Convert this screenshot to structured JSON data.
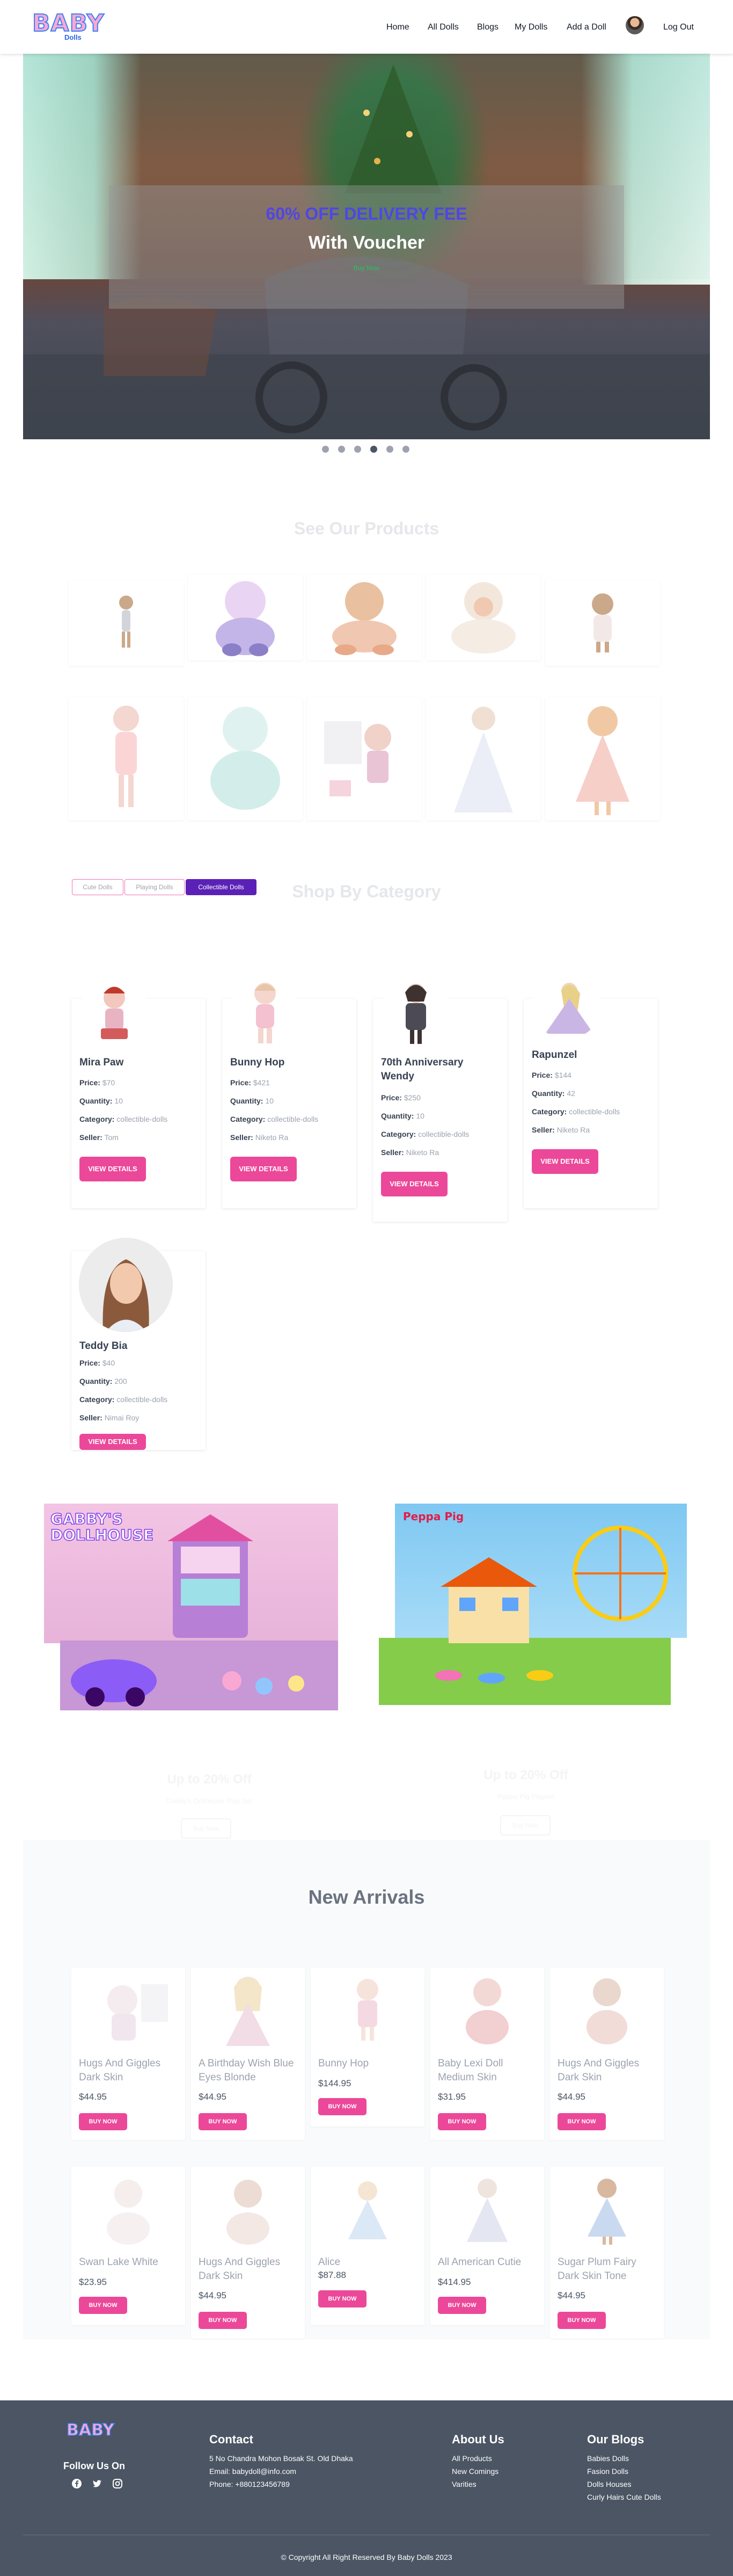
{
  "brand": {
    "logo_main": "BABY",
    "logo_sub": "Dolls"
  },
  "nav": {
    "items": [
      "Home",
      "All Dolls",
      "Blogs",
      "My Dolls",
      "Add a Doll"
    ],
    "logout": "Log Out"
  },
  "hero": {
    "headline": "60% OFF DELIVERY FEE",
    "subheadline": "With Voucher",
    "cta": "Buy Now",
    "slides": 6,
    "active_slide": 4
  },
  "gallery": {
    "title": "See Our Products"
  },
  "category": {
    "title": "Shop By Category",
    "tabs": [
      "Cute Dolls",
      "Playing Dolls",
      "Collectible Dolls"
    ],
    "active_tab": "Collectible Dolls",
    "labels": {
      "price": "Price:",
      "quantity": "Quantity:",
      "category": "Category:",
      "seller": "Seller:"
    },
    "button": "VIEW DETAILS",
    "products": [
      {
        "name": "Mira Paw",
        "price": "$70",
        "quantity": "10",
        "category": "collectible-dolls",
        "seller": "Tom"
      },
      {
        "name": "Bunny Hop",
        "price": "$421",
        "quantity": "10",
        "category": "collectible-dolls",
        "seller": "Niketo Ra"
      },
      {
        "name": "70th Anniversary Wendy",
        "price": "$250",
        "quantity": "10",
        "category": "collectible-dolls",
        "seller": "Niketo Ra"
      },
      {
        "name": "Rapunzel",
        "price": "$144",
        "quantity": "42",
        "category": "collectible-dolls",
        "seller": "Niketo Ra"
      },
      {
        "name": "Teddy Bia",
        "price": "$40",
        "quantity": "200",
        "category": "collectible-dolls",
        "seller": "Nimai Roy"
      }
    ]
  },
  "promos": [
    {
      "logo_text": "GABBY'S DOLLHOUSE",
      "title": "Up to 20% Off",
      "subtitle": "Gabby's Dollhouse Play Set",
      "button": "Buy Now"
    },
    {
      "logo_text": "Peppa Pig",
      "title": "Up to 20% Off",
      "subtitle": "Peppa Pig Playset",
      "button": "Buy Now"
    }
  ],
  "new_arrivals": {
    "title": "New Arrivals",
    "button": "BUY NOW",
    "items": [
      {
        "name": "Hugs And Giggles Dark Skin",
        "price": "$44.95"
      },
      {
        "name": "A Birthday Wish Blue Eyes Blonde",
        "price": "$44.95"
      },
      {
        "name": "Bunny Hop",
        "price": "$144.95"
      },
      {
        "name": "Baby Lexi Doll Medium Skin",
        "price": "$31.95"
      },
      {
        "name": "Hugs And Giggles Dark Skin",
        "price": "$44.95"
      },
      {
        "name": "Swan Lake White",
        "price": "$23.95"
      },
      {
        "name": "Hugs And Giggles Dark Skin",
        "price": "$44.95"
      },
      {
        "name": "Alice",
        "price": "$87.88"
      },
      {
        "name": "All American Cutie",
        "price": "$414.95"
      },
      {
        "name": "Sugar Plum Fairy Dark Skin Tone",
        "price": "$44.95"
      }
    ]
  },
  "footer": {
    "follow": "Follow Us On",
    "contact_title": "Contact",
    "contact": [
      "5 No Chandra Mohon Bosak St. Old Dhaka",
      "Email: babydoll@info.com",
      "Phone: +880123456789"
    ],
    "about_title": "About Us",
    "about": [
      "All Products",
      "New Comings",
      "Varities"
    ],
    "blogs_title": "Our Blogs",
    "blogs": [
      "Babies Dolls",
      "Fasion Dolls",
      "Dolls Houses",
      "Curly Hairs Cute Dolls"
    ],
    "copyright": "© Copyright All Right Reserved By Baby Dolls 2023"
  },
  "colors": {
    "primary_pink": "#ec4899",
    "accent_purple": "#5b21b6",
    "hero_headline": "#4f46e5",
    "footer_bg": "#4b5563"
  }
}
